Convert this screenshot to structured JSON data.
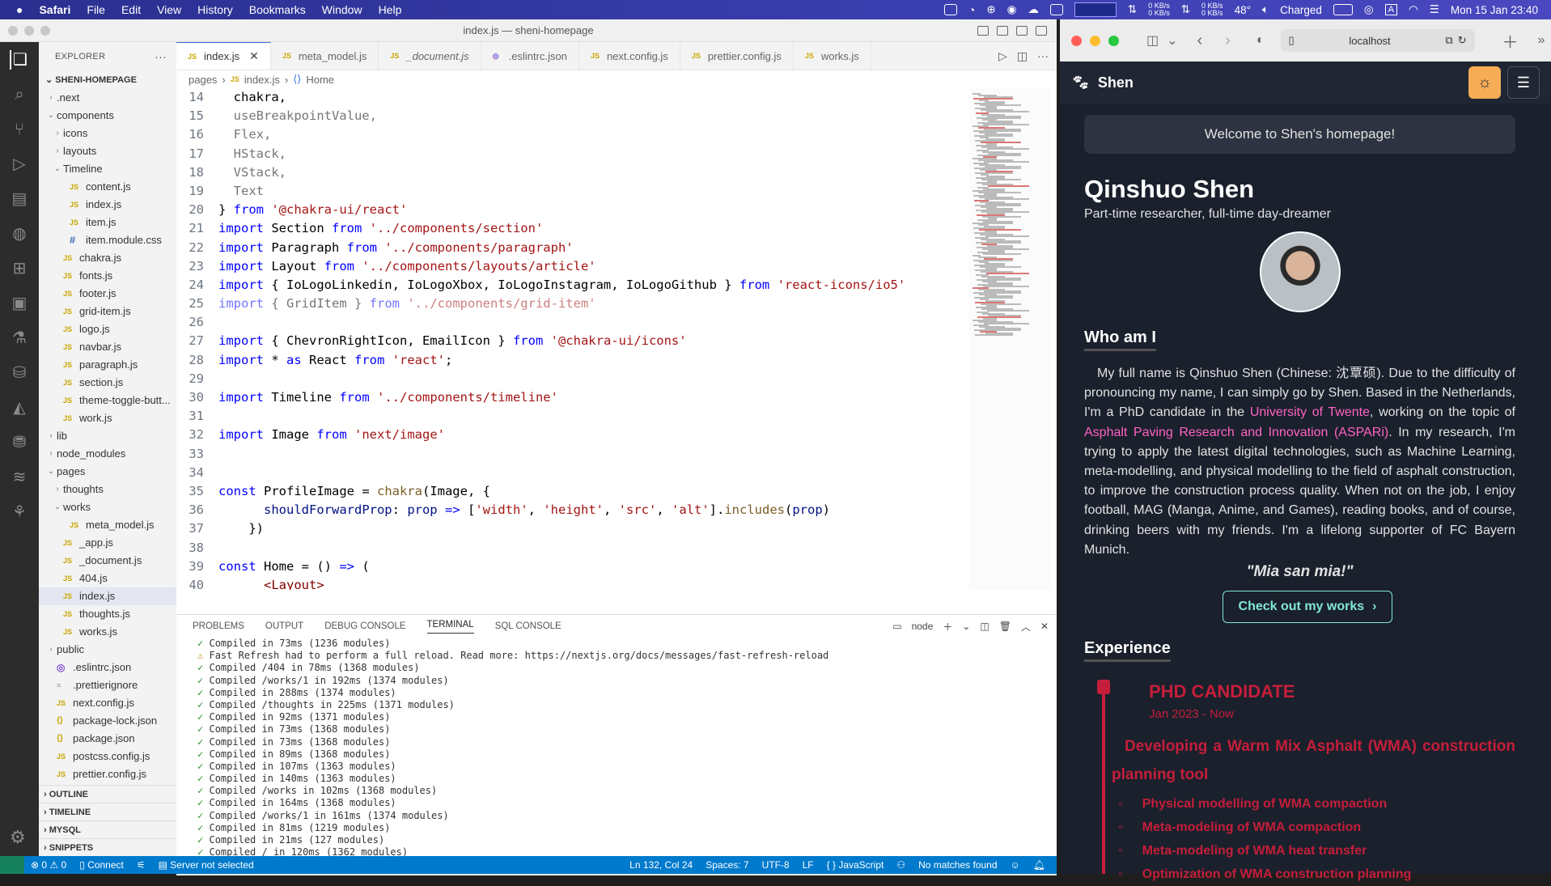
{
  "menubar": {
    "app": "Safari",
    "items": [
      "File",
      "Edit",
      "View",
      "History",
      "Bookmarks",
      "Window",
      "Help"
    ],
    "netstat_up": "0 KB/s",
    "netstat_down": "0 KB/s",
    "netstat_up2": "0 KB/s",
    "netstat_down2": "0 KB/s",
    "temp": "48°",
    "battery": "Charged",
    "datetime": "Mon 15 Jan  23:40",
    "input_source": "A"
  },
  "vscode": {
    "title": "index.js — sheni-homepage",
    "explorer_title": "EXPLORER",
    "project": "SHENI-HOMEPAGE",
    "tree": [
      {
        "label": ".next",
        "indent": 0,
        "kind": "folder",
        "open": false
      },
      {
        "label": "components",
        "indent": 0,
        "kind": "folder",
        "open": true
      },
      {
        "label": "icons",
        "indent": 1,
        "kind": "folder",
        "open": false
      },
      {
        "label": "layouts",
        "indent": 1,
        "kind": "folder",
        "open": false
      },
      {
        "label": "Timeline",
        "indent": 1,
        "kind": "folder",
        "open": true
      },
      {
        "label": "content.js",
        "indent": 2,
        "kind": "js"
      },
      {
        "label": "index.js",
        "indent": 2,
        "kind": "js"
      },
      {
        "label": "item.js",
        "indent": 2,
        "kind": "js"
      },
      {
        "label": "item.module.css",
        "indent": 2,
        "kind": "css"
      },
      {
        "label": "chakra.js",
        "indent": 1,
        "kind": "js"
      },
      {
        "label": "fonts.js",
        "indent": 1,
        "kind": "js"
      },
      {
        "label": "footer.js",
        "indent": 1,
        "kind": "js"
      },
      {
        "label": "grid-item.js",
        "indent": 1,
        "kind": "js"
      },
      {
        "label": "logo.js",
        "indent": 1,
        "kind": "js"
      },
      {
        "label": "navbar.js",
        "indent": 1,
        "kind": "js"
      },
      {
        "label": "paragraph.js",
        "indent": 1,
        "kind": "js"
      },
      {
        "label": "section.js",
        "indent": 1,
        "kind": "js"
      },
      {
        "label": "theme-toggle-butt...",
        "indent": 1,
        "kind": "js"
      },
      {
        "label": "work.js",
        "indent": 1,
        "kind": "js"
      },
      {
        "label": "lib",
        "indent": 0,
        "kind": "folder",
        "open": false
      },
      {
        "label": "node_modules",
        "indent": 0,
        "kind": "folder",
        "open": false
      },
      {
        "label": "pages",
        "indent": 0,
        "kind": "folder",
        "open": true
      },
      {
        "label": "thoughts",
        "indent": 1,
        "kind": "folder",
        "open": false
      },
      {
        "label": "works",
        "indent": 1,
        "kind": "folder",
        "open": true
      },
      {
        "label": "meta_model.js",
        "indent": 2,
        "kind": "js"
      },
      {
        "label": "_app.js",
        "indent": 1,
        "kind": "js"
      },
      {
        "label": "_document.js",
        "indent": 1,
        "kind": "js"
      },
      {
        "label": "404.js",
        "indent": 1,
        "kind": "js"
      },
      {
        "label": "index.js",
        "indent": 1,
        "kind": "js",
        "selected": true
      },
      {
        "label": "thoughts.js",
        "indent": 1,
        "kind": "js"
      },
      {
        "label": "works.js",
        "indent": 1,
        "kind": "js"
      },
      {
        "label": "public",
        "indent": 0,
        "kind": "folder",
        "open": false
      },
      {
        "label": ".eslintrc.json",
        "indent": 0,
        "kind": "eslint"
      },
      {
        "label": ".prettierignore",
        "indent": 0,
        "kind": "ignore"
      },
      {
        "label": "next.config.js",
        "indent": 0,
        "kind": "js"
      },
      {
        "label": "package-lock.json",
        "indent": 0,
        "kind": "json"
      },
      {
        "label": "package.json",
        "indent": 0,
        "kind": "json"
      },
      {
        "label": "postcss.config.js",
        "indent": 0,
        "kind": "js"
      },
      {
        "label": "prettier.config.js",
        "indent": 0,
        "kind": "js"
      }
    ],
    "sections": [
      "OUTLINE",
      "TIMELINE",
      "MYSQL",
      "SNIPPETS"
    ],
    "tabs": [
      {
        "label": "index.js",
        "active": true,
        "italic": false,
        "icon": "JS"
      },
      {
        "label": "meta_model.js",
        "active": false,
        "italic": false,
        "icon": "JS"
      },
      {
        "label": "_document.js",
        "active": false,
        "italic": true,
        "icon": "JS"
      },
      {
        "label": ".eslintrc.json",
        "active": false,
        "italic": false,
        "icon": "◎"
      },
      {
        "label": "next.config.js",
        "active": false,
        "italic": false,
        "icon": "JS"
      },
      {
        "label": "prettier.config.js",
        "active": false,
        "italic": false,
        "icon": "JS"
      },
      {
        "label": "works.js",
        "active": false,
        "italic": false,
        "icon": "JS"
      }
    ],
    "breadcrumb": [
      "pages",
      "index.js",
      "Home"
    ],
    "code": [
      {
        "n": "14",
        "text": "  chakra,"
      },
      {
        "n": "15",
        "text": "  useBreakpointValue,"
      },
      {
        "n": "16",
        "text": "  Flex,"
      },
      {
        "n": "17",
        "text": "  HStack,"
      },
      {
        "n": "18",
        "text": "  VStack,"
      },
      {
        "n": "19",
        "text": "  Text"
      },
      {
        "n": "20",
        "text": "} from '@chakra-ui/react'"
      },
      {
        "n": "21",
        "text": "import Section from '../components/section'"
      },
      {
        "n": "22",
        "text": "import Paragraph from '../components/paragraph'"
      },
      {
        "n": "23",
        "text": "import Layout from '../components/layouts/article'"
      },
      {
        "n": "24",
        "text": "import { IoLogoLinkedin, IoLogoXbox, IoLogoInstagram, IoLogoGithub } from 'react-icons/io5'"
      },
      {
        "n": "25",
        "text": "import { GridItem } from '../components/grid-item'"
      },
      {
        "n": "26",
        "text": ""
      },
      {
        "n": "27",
        "text": "import { ChevronRightIcon, EmailIcon } from '@chakra-ui/icons'"
      },
      {
        "n": "28",
        "text": "import * as React from 'react';"
      },
      {
        "n": "29",
        "text": ""
      },
      {
        "n": "30",
        "text": "import Timeline from '../components/timeline'"
      },
      {
        "n": "31",
        "text": ""
      },
      {
        "n": "32",
        "text": "import Image from 'next/image'"
      },
      {
        "n": "33",
        "text": ""
      },
      {
        "n": "34",
        "text": ""
      },
      {
        "n": "35",
        "text": "const ProfileImage = chakra(Image, {"
      },
      {
        "n": "36",
        "text": "      shouldForwardProp: prop => ['width', 'height', 'src', 'alt'].includes(prop)"
      },
      {
        "n": "37",
        "text": "    })"
      },
      {
        "n": "38",
        "text": ""
      },
      {
        "n": "39",
        "text": "const Home = () => ("
      },
      {
        "n": "40",
        "text": "      <Layout>"
      }
    ],
    "panel_tabs": [
      "PROBLEMS",
      "OUTPUT",
      "DEBUG CONSOLE",
      "TERMINAL",
      "SQL CONSOLE"
    ],
    "panel_active": "TERMINAL",
    "terminal_shell": "node",
    "terminal": [
      {
        "mark": "✓",
        "type": "ok",
        "text": "Compiled in 73ms (1236 modules)"
      },
      {
        "mark": "⚠",
        "type": "warn",
        "text": "Fast Refresh had to perform a full reload. Read more: https://nextjs.org/docs/messages/fast-refresh-reload"
      },
      {
        "mark": "✓",
        "type": "ok",
        "text": "Compiled /404 in 78ms (1368 modules)"
      },
      {
        "mark": "✓",
        "type": "ok",
        "text": "Compiled /works/1 in 192ms (1374 modules)"
      },
      {
        "mark": "✓",
        "type": "ok",
        "text": "Compiled in 288ms (1374 modules)"
      },
      {
        "mark": "✓",
        "type": "ok",
        "text": "Compiled /thoughts in 225ms (1371 modules)"
      },
      {
        "mark": "✓",
        "type": "ok",
        "text": "Compiled in 92ms (1371 modules)"
      },
      {
        "mark": "✓",
        "type": "ok",
        "text": "Compiled in 73ms (1368 modules)"
      },
      {
        "mark": "✓",
        "type": "ok",
        "text": "Compiled in 73ms (1368 modules)"
      },
      {
        "mark": "✓",
        "type": "ok",
        "text": "Compiled in 89ms (1368 modules)"
      },
      {
        "mark": "✓",
        "type": "ok",
        "text": "Compiled in 107ms (1363 modules)"
      },
      {
        "mark": "✓",
        "type": "ok",
        "text": "Compiled in 140ms (1363 modules)"
      },
      {
        "mark": "✓",
        "type": "ok",
        "text": "Compiled /works in 102ms (1368 modules)"
      },
      {
        "mark": "✓",
        "type": "ok",
        "text": "Compiled in 164ms (1368 modules)"
      },
      {
        "mark": "✓",
        "type": "ok",
        "text": "Compiled /works/1 in 161ms (1374 modules)"
      },
      {
        "mark": "✓",
        "type": "ok",
        "text": "Compiled in 81ms (1219 modules)"
      },
      {
        "mark": "✓",
        "type": "ok",
        "text": "Compiled in 21ms (127 modules)"
      },
      {
        "mark": "✓",
        "type": "ok",
        "text": "Compiled / in 120ms (1362 modules)"
      }
    ],
    "status": {
      "errors": "0",
      "warnings": "0",
      "connect": "Connect",
      "server": "Server not selected",
      "position": "Ln 132, Col 24",
      "spaces": "Spaces: 7",
      "encoding": "UTF-8",
      "eol": "LF",
      "language": "JavaScript",
      "search": "No matches found"
    }
  },
  "safari": {
    "url": "localhost",
    "site_logo": "Shen",
    "welcome": "Welcome to Shen's homepage!",
    "name": "Qinshuo Shen",
    "subtitle": "Part-time researcher, full-time day-dreamer",
    "who_title": "Who am I",
    "bio_1": "My full name is Qinshuo Shen (Chinese: 沈覃硕). Due to the difficulty of pronouncing my name, I can simply go by Shen. Based in the Netherlands, I'm a PhD candidate in the ",
    "bio_link_1": "University of Twente",
    "bio_2": ", working on the topic of ",
    "bio_link_2": "Asphalt Paving Research and Innovation (ASPARi)",
    "bio_3": ". In my research, I'm trying to apply the latest digital technologies, such as Machine Learning, meta-modelling, and physical modelling to the field of asphalt construction, to improve the construction process quality. When not on the job, I enjoy football, MAG (Manga, Anime, and Games), reading books, and of course, drinking beers with my friends. I'm a lifelong supporter of FC Bayern Munich.",
    "motto": "\"Mia san mia!\"",
    "cta": "Check out my works",
    "experience_title": "Experience",
    "job_title": "PHD CANDIDATE",
    "job_date": "Jan 2023 - Now",
    "job_desc": "Developing a Warm Mix Asphalt (WMA) construction planning tool",
    "job_bullets": [
      "Physical modelling of WMA compaction",
      "Meta-modeling of WMA compaction",
      "Meta-modeling of WMA heat transfer",
      "Optimization of WMA construction planning"
    ],
    "colors": {
      "accent": "#f6ad55",
      "link": "#ff63c3",
      "timeline": "#c41e3a",
      "cta": "#81e6d9"
    }
  }
}
